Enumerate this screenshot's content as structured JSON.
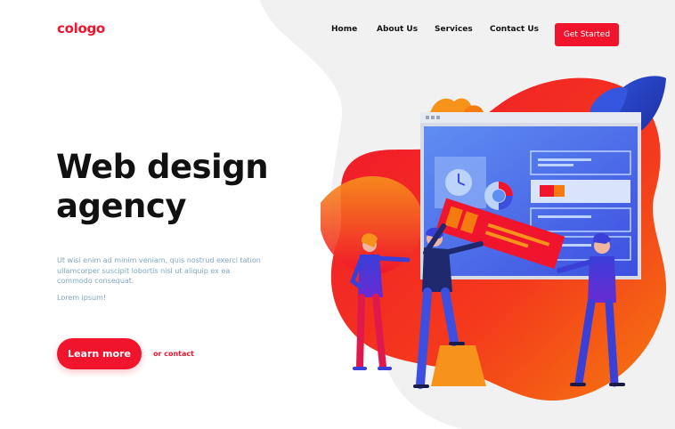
{
  "brand": {
    "logo_text": "cologo"
  },
  "nav": {
    "items": [
      {
        "label": "Home"
      },
      {
        "label": "About Us"
      },
      {
        "label": "Services"
      },
      {
        "label": "Contact Us"
      }
    ],
    "cta_label": "Get Started"
  },
  "hero": {
    "title_line1": "Web design",
    "title_line2": "agency",
    "description": "Ut wisi enim ad minim veniam, quis nostrud exerci tation ullamcorper suscipit lobortis nisl ut aliquip ex ea commodo consequat.",
    "small_text": "Lorem ipsum!",
    "primary_button": "Learn more",
    "secondary_link": "or contact"
  },
  "colors": {
    "accent": "#f0142d",
    "text_dark": "#111111",
    "text_muted": "#7fa6c6",
    "background_blob": "#f1f1f1"
  }
}
